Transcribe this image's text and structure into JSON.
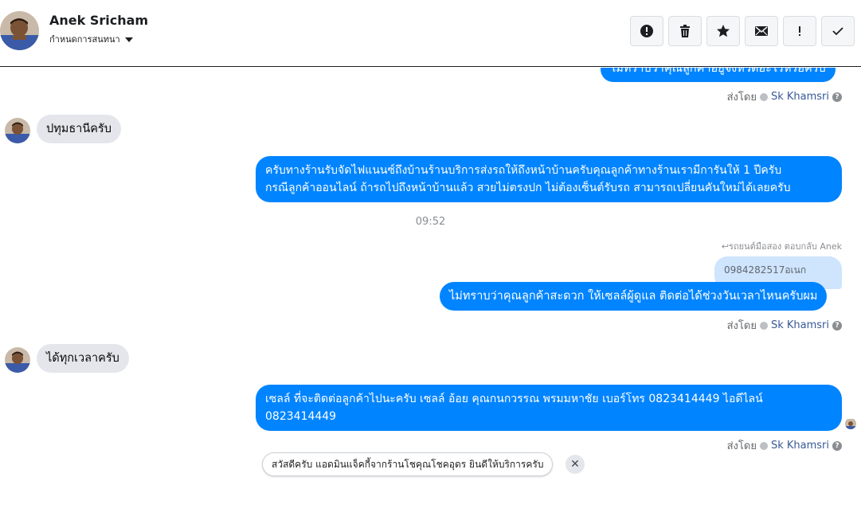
{
  "header": {
    "contact_name": "Anek Sricham",
    "contact_sub": "กำหนดการสนทนา",
    "actions": [
      {
        "name": "report-button",
        "icon": "alert-circle-icon"
      },
      {
        "name": "delete-button",
        "icon": "trash-icon"
      },
      {
        "name": "star-button",
        "icon": "star-icon"
      },
      {
        "name": "mark-unread-button",
        "icon": "envelope-icon"
      },
      {
        "name": "important-button",
        "icon": "exclamation-icon"
      },
      {
        "name": "done-button",
        "icon": "check-icon"
      }
    ]
  },
  "messages": {
    "m0_text": "ไม่ทราบว่าคุณลูกค้าอยู่จังหวัดอะไรหรอครับ",
    "sent_by_label": "ส่งโดย",
    "sent_by_name": "Sk Khamsri",
    "help_glyph": "?",
    "m1_text": "ปทุมธานีครับ",
    "m2_line1": "ครับทางร้านรับจัดไฟแนนซ์ถึงบ้านร้านบริการส่งรถให้ถึงหน้าบ้านครับคุณลูกค้าทางร้านเรามีการันให้ 1 ปีครับ",
    "m2_line2": "กรณีลูกค้าออนไลน์ ถ้ารถไปถึงหน้าบ้านแล้ว สวยไม่ตรงปก ไม่ต้องเซ็นต์รับรถ สามารถเปลี่ยนคันใหม่ได้เลยครับ",
    "time": "09:52",
    "reply_note": "รถยนต์มือสอง ตอบกลับ Anek",
    "quoted_text": "0984282517อเนก",
    "m3_text": "ไม่ทราบว่าคุณลูกค้าสะดวก ให้เซลล์ผู้ดูแล ติดต่อได้ช่วงวันเวลาไหนครับผม",
    "m4_text": "ได้ทุกเวลาครับ",
    "m5_line1": "เซลล์ ที่จะติดต่อลูกค้าไปนะครับ เซลล์ อ้อย คุณกนกวรรณ พรมมหาชัย เบอร์โทร 0823414449 ไอดีไลน์",
    "m5_line2": "0823414449"
  },
  "suggestion": {
    "text": "สวัสดีครับ แอดมินแจ็คกี้จากร้านโชคุณโชคอุดร ยินดีให้บริการครับ",
    "close_glyph": "✕"
  },
  "colors": {
    "outgoing": "#0084ff",
    "incoming": "#e4e6eb",
    "quoted": "#cfe4fd"
  }
}
